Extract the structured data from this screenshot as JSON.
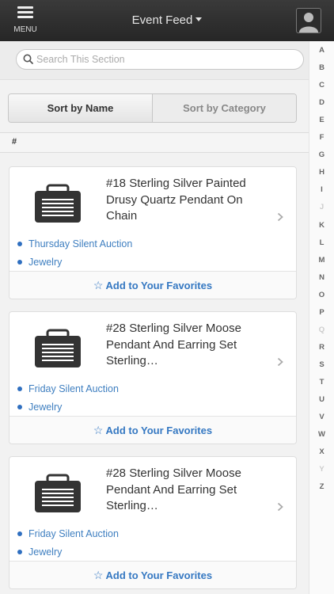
{
  "header": {
    "menu_label": "MENU",
    "title": "Event Feed"
  },
  "search": {
    "placeholder": "Search This Section"
  },
  "sort": {
    "by_name": "Sort by Name",
    "by_category": "Sort by Category",
    "selected": "Sort by Name"
  },
  "section_header": "#",
  "items": [
    {
      "title": "#18 Sterling Silver Painted Drusy Quartz Pendant On Chain",
      "auction": "Thursday Silent Auction",
      "category": "Jewelry",
      "favorite_label": "Add to Your Favorites"
    },
    {
      "title": "#28 Sterling Silver Moose Pendant And Earring Set Sterling…",
      "auction": "Friday Silent Auction",
      "category": "Jewelry",
      "favorite_label": "Add to Your Favorites"
    },
    {
      "title": "#28 Sterling Silver Moose Pendant And Earring Set Sterling…",
      "auction": "Friday Silent Auction",
      "category": "Jewelry",
      "favorite_label": "Add to Your Favorites"
    }
  ],
  "index_letters": [
    {
      "l": "A",
      "dim": false
    },
    {
      "l": "B",
      "dim": false
    },
    {
      "l": "C",
      "dim": false
    },
    {
      "l": "D",
      "dim": false
    },
    {
      "l": "E",
      "dim": false
    },
    {
      "l": "F",
      "dim": false
    },
    {
      "l": "G",
      "dim": false
    },
    {
      "l": "H",
      "dim": false
    },
    {
      "l": "I",
      "dim": false
    },
    {
      "l": "J",
      "dim": true
    },
    {
      "l": "K",
      "dim": false
    },
    {
      "l": "L",
      "dim": false
    },
    {
      "l": "M",
      "dim": false
    },
    {
      "l": "N",
      "dim": false
    },
    {
      "l": "O",
      "dim": false
    },
    {
      "l": "P",
      "dim": false
    },
    {
      "l": "Q",
      "dim": true
    },
    {
      "l": "R",
      "dim": false
    },
    {
      "l": "S",
      "dim": false
    },
    {
      "l": "T",
      "dim": false
    },
    {
      "l": "U",
      "dim": false
    },
    {
      "l": "V",
      "dim": false
    },
    {
      "l": "W",
      "dim": false
    },
    {
      "l": "X",
      "dim": false
    },
    {
      "l": "Y",
      "dim": true
    },
    {
      "l": "Z",
      "dim": false
    }
  ],
  "colors": {
    "header_bg": "#2e2e2e",
    "link_blue": "#3578c2",
    "dot_blue": "#2f6fc0"
  },
  "icons": {
    "menu": "hamburger-icon",
    "avatar": "user-avatar-icon",
    "search": "magnifier-icon",
    "item": "briefcase-icon",
    "chevron": "chevron-right-icon",
    "favorite": "star-outline-icon"
  }
}
